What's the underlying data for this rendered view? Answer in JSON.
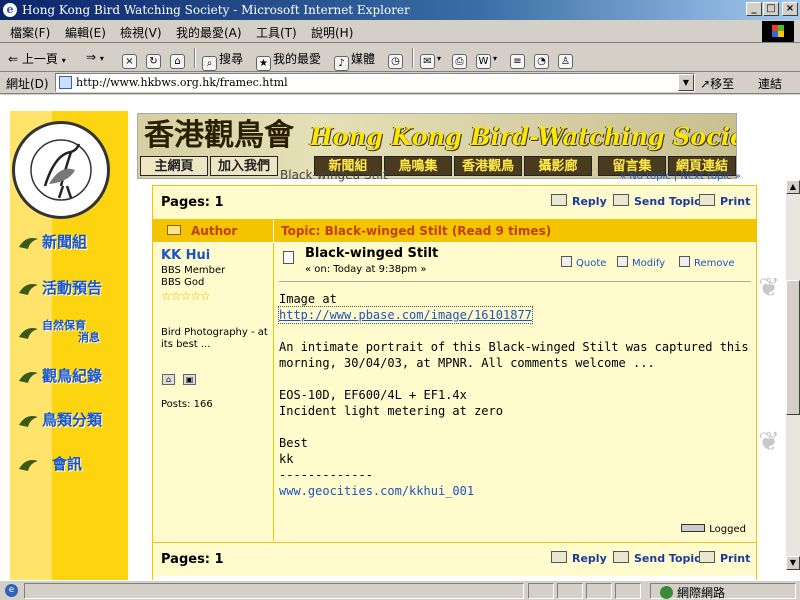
{
  "window": {
    "title": "Hong Kong Bird Watching Society - Microsoft Internet Explorer",
    "app_icon": "ie-icon",
    "controls": {
      "minimize": "_",
      "maximize": "□",
      "close": "×"
    }
  },
  "menu": [
    "檔案(F)",
    "編輯(E)",
    "檢視(V)",
    "我的最愛(A)",
    "工具(T)",
    "說明(H)"
  ],
  "toolbar": {
    "back": "上一頁",
    "search": "搜尋",
    "favorites": "我的最愛",
    "media": "媒體"
  },
  "address": {
    "label": "網址(D)",
    "url": "http://www.hkbws.org.hk/framec.html",
    "go": "移至",
    "links": "連結"
  },
  "site": {
    "banner_zh": "香港觀鳥會",
    "banner_en": "Hong Kong Bird-Watching Society",
    "tabs": [
      "主網頁",
      "加入我們",
      "新聞組",
      "鳥鳴集",
      "香港觀鳥",
      "攝影廊",
      "留言集",
      "網頁連結"
    ],
    "behind_text": "Black-winged Stilt",
    "behind_nav": "« No topic | Next topic »",
    "nav": [
      {
        "label": "新聞組"
      },
      {
        "label": "活動預告"
      },
      {
        "label": "自然保育",
        "label2": "消息"
      },
      {
        "label": "觀鳥紀錄"
      },
      {
        "label": "鳥類分類"
      },
      {
        "label": "會訊"
      }
    ]
  },
  "forum": {
    "pages": "Pages: 1",
    "actions": {
      "reply": "Reply",
      "send": "Send Topic",
      "print": "Print"
    },
    "author_header": "Author",
    "topic_header": "Topic: Black-winged Stilt  (Read 9 times)",
    "post": {
      "user": "KK Hui",
      "rank1": "BBS Member",
      "rank2": "BBS God",
      "stars": "☆☆☆☆☆",
      "signature": "Bird Photography - at its best ...",
      "posts": "Posts: 166",
      "title": "Black-winged Stilt",
      "date_on": "« on: Today at 9:38pm »",
      "quote": "Quote",
      "modify": "Modify",
      "remove": "Remove",
      "body_line1": "Image at",
      "body_link": "http://www.pbase.com/image/16101877",
      "body_p2a": "An intimate portrait of this Black-winged Stilt was captured this",
      "body_p2b": "morning, 30/04/03, at MPNR.  All comments welcome ...",
      "body_p3a": "EOS-10D, EF600/4L + EF1.4x",
      "body_p3b": "Incident light metering at zero",
      "body_p4a": "Best",
      "body_p4b": "kk",
      "body_dash": "-------------",
      "body_site": "www.geocities.com/kkhui_001",
      "logged": "Logged"
    }
  },
  "status": {
    "zone": "網際網路"
  },
  "colors": {
    "sidebar": "#fcd40f",
    "header": "#f5c400",
    "post_bg": "#fffbcc",
    "link": "#1a55c4",
    "accent_text": "#c04000"
  }
}
